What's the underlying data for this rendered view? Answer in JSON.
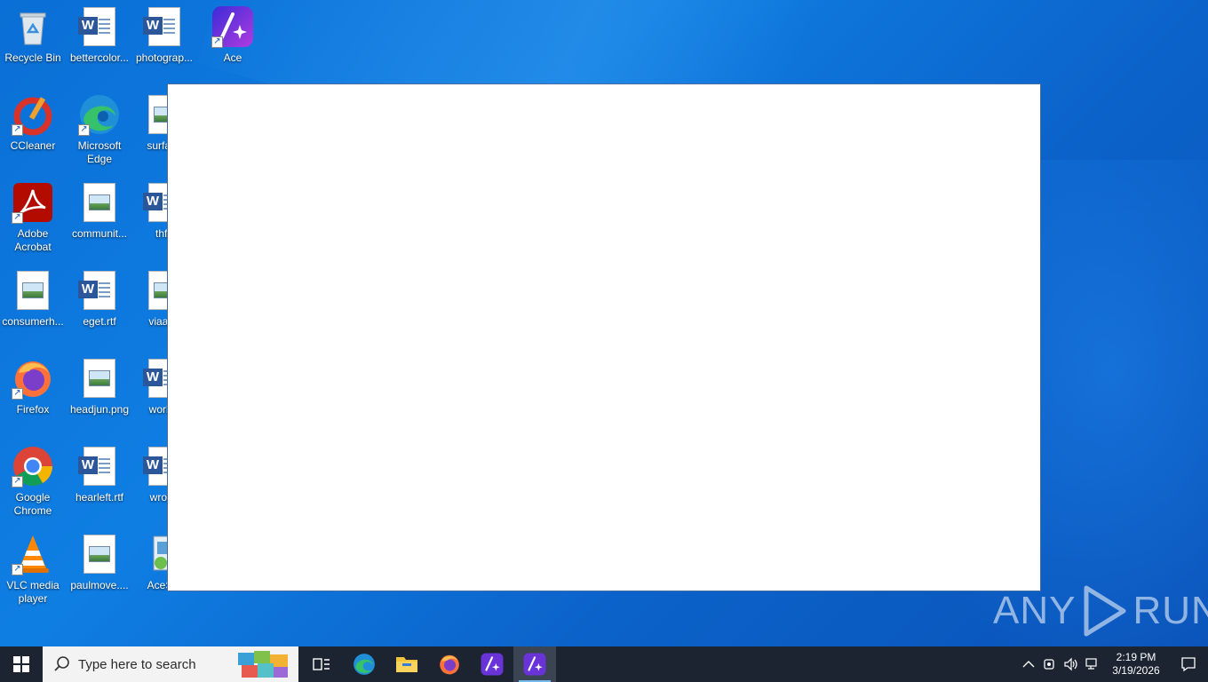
{
  "desktop": {
    "icons": [
      {
        "label": "Recycle Bin",
        "icon": "recycle-bin-icon"
      },
      {
        "label": "bettercolor...",
        "icon": "word-doc-icon"
      },
      {
        "label": "photograp...",
        "icon": "word-doc-icon"
      },
      {
        "label": "Ace",
        "icon": "ace-app-icon"
      },
      {
        "label": "CCleaner",
        "icon": "ccleaner-icon"
      },
      {
        "label": "Microsoft Edge",
        "icon": "edge-icon"
      },
      {
        "label": "surface",
        "icon": "image-file-icon"
      },
      {
        "label": "Adobe Acrobat",
        "icon": "acrobat-icon"
      },
      {
        "label": "communit...",
        "icon": "image-file-icon"
      },
      {
        "label": "thfa",
        "icon": "word-doc-icon"
      },
      {
        "label": "consumerh...",
        "icon": "image-file-icon"
      },
      {
        "label": "eget.rtf",
        "icon": "word-doc-icon"
      },
      {
        "label": "viaage",
        "icon": "image-file-icon"
      },
      {
        "label": "Firefox",
        "icon": "firefox-icon"
      },
      {
        "label": "headjun.png",
        "icon": "image-file-icon"
      },
      {
        "label": "workin",
        "icon": "word-doc-icon"
      },
      {
        "label": "Google Chrome",
        "icon": "chrome-icon"
      },
      {
        "label": "hearleft.rtf",
        "icon": "word-doc-icon"
      },
      {
        "label": "wrong",
        "icon": "word-doc-icon"
      },
      {
        "label": "VLC media player",
        "icon": "vlc-icon"
      },
      {
        "label": "paulmove....",
        "icon": "image-file-icon"
      },
      {
        "label": "AceSet",
        "icon": "installer-icon"
      }
    ]
  },
  "watermark": {
    "left": "ANY",
    "right": "RUN"
  },
  "taskbar": {
    "search_placeholder": "Type here to search",
    "pinned": [
      "task-view-icon",
      "edge-icon",
      "file-explorer-icon",
      "firefox-icon",
      "ace-app-icon",
      "ace-app-icon"
    ],
    "clock": {
      "time": "2:19 PM",
      "date": "3/19/2026"
    },
    "colors": {
      "taskbar": "#1b2430",
      "accent": "#76b9ed"
    }
  }
}
